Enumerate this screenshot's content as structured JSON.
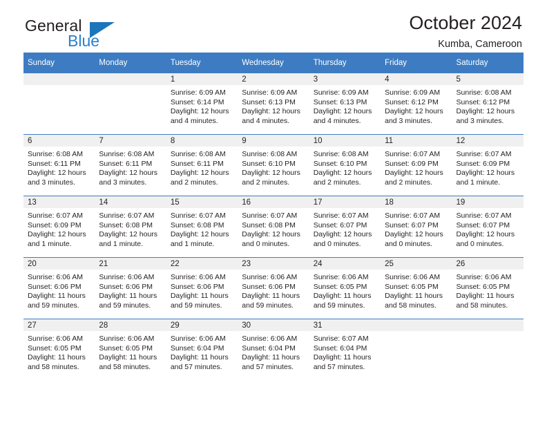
{
  "brand": {
    "name_top": "General",
    "name_bottom": "Blue",
    "accent_color": "#1b75bb",
    "logo_icon": "triangle-icon"
  },
  "header": {
    "title": "October 2024",
    "subtitle": "Kumba, Cameroon"
  },
  "calendar": {
    "header_bg": "#3d7cc2",
    "daynum_bg": "#f0f0f0",
    "weekdays": [
      "Sunday",
      "Monday",
      "Tuesday",
      "Wednesday",
      "Thursday",
      "Friday",
      "Saturday"
    ],
    "weeks": [
      [
        {
          "day": "",
          "empty": true
        },
        {
          "day": "",
          "empty": true
        },
        {
          "day": "1",
          "sunrise": "Sunrise: 6:09 AM",
          "sunset": "Sunset: 6:14 PM",
          "daylight1": "Daylight: 12 hours",
          "daylight2": "and 4 minutes."
        },
        {
          "day": "2",
          "sunrise": "Sunrise: 6:09 AM",
          "sunset": "Sunset: 6:13 PM",
          "daylight1": "Daylight: 12 hours",
          "daylight2": "and 4 minutes."
        },
        {
          "day": "3",
          "sunrise": "Sunrise: 6:09 AM",
          "sunset": "Sunset: 6:13 PM",
          "daylight1": "Daylight: 12 hours",
          "daylight2": "and 4 minutes."
        },
        {
          "day": "4",
          "sunrise": "Sunrise: 6:09 AM",
          "sunset": "Sunset: 6:12 PM",
          "daylight1": "Daylight: 12 hours",
          "daylight2": "and 3 minutes."
        },
        {
          "day": "5",
          "sunrise": "Sunrise: 6:08 AM",
          "sunset": "Sunset: 6:12 PM",
          "daylight1": "Daylight: 12 hours",
          "daylight2": "and 3 minutes."
        }
      ],
      [
        {
          "day": "6",
          "sunrise": "Sunrise: 6:08 AM",
          "sunset": "Sunset: 6:11 PM",
          "daylight1": "Daylight: 12 hours",
          "daylight2": "and 3 minutes."
        },
        {
          "day": "7",
          "sunrise": "Sunrise: 6:08 AM",
          "sunset": "Sunset: 6:11 PM",
          "daylight1": "Daylight: 12 hours",
          "daylight2": "and 3 minutes."
        },
        {
          "day": "8",
          "sunrise": "Sunrise: 6:08 AM",
          "sunset": "Sunset: 6:11 PM",
          "daylight1": "Daylight: 12 hours",
          "daylight2": "and 2 minutes."
        },
        {
          "day": "9",
          "sunrise": "Sunrise: 6:08 AM",
          "sunset": "Sunset: 6:10 PM",
          "daylight1": "Daylight: 12 hours",
          "daylight2": "and 2 minutes."
        },
        {
          "day": "10",
          "sunrise": "Sunrise: 6:08 AM",
          "sunset": "Sunset: 6:10 PM",
          "daylight1": "Daylight: 12 hours",
          "daylight2": "and 2 minutes."
        },
        {
          "day": "11",
          "sunrise": "Sunrise: 6:07 AM",
          "sunset": "Sunset: 6:09 PM",
          "daylight1": "Daylight: 12 hours",
          "daylight2": "and 2 minutes."
        },
        {
          "day": "12",
          "sunrise": "Sunrise: 6:07 AM",
          "sunset": "Sunset: 6:09 PM",
          "daylight1": "Daylight: 12 hours",
          "daylight2": "and 1 minute."
        }
      ],
      [
        {
          "day": "13",
          "sunrise": "Sunrise: 6:07 AM",
          "sunset": "Sunset: 6:09 PM",
          "daylight1": "Daylight: 12 hours",
          "daylight2": "and 1 minute."
        },
        {
          "day": "14",
          "sunrise": "Sunrise: 6:07 AM",
          "sunset": "Sunset: 6:08 PM",
          "daylight1": "Daylight: 12 hours",
          "daylight2": "and 1 minute."
        },
        {
          "day": "15",
          "sunrise": "Sunrise: 6:07 AM",
          "sunset": "Sunset: 6:08 PM",
          "daylight1": "Daylight: 12 hours",
          "daylight2": "and 1 minute."
        },
        {
          "day": "16",
          "sunrise": "Sunrise: 6:07 AM",
          "sunset": "Sunset: 6:08 PM",
          "daylight1": "Daylight: 12 hours",
          "daylight2": "and 0 minutes."
        },
        {
          "day": "17",
          "sunrise": "Sunrise: 6:07 AM",
          "sunset": "Sunset: 6:07 PM",
          "daylight1": "Daylight: 12 hours",
          "daylight2": "and 0 minutes."
        },
        {
          "day": "18",
          "sunrise": "Sunrise: 6:07 AM",
          "sunset": "Sunset: 6:07 PM",
          "daylight1": "Daylight: 12 hours",
          "daylight2": "and 0 minutes."
        },
        {
          "day": "19",
          "sunrise": "Sunrise: 6:07 AM",
          "sunset": "Sunset: 6:07 PM",
          "daylight1": "Daylight: 12 hours",
          "daylight2": "and 0 minutes."
        }
      ],
      [
        {
          "day": "20",
          "sunrise": "Sunrise: 6:06 AM",
          "sunset": "Sunset: 6:06 PM",
          "daylight1": "Daylight: 11 hours",
          "daylight2": "and 59 minutes."
        },
        {
          "day": "21",
          "sunrise": "Sunrise: 6:06 AM",
          "sunset": "Sunset: 6:06 PM",
          "daylight1": "Daylight: 11 hours",
          "daylight2": "and 59 minutes."
        },
        {
          "day": "22",
          "sunrise": "Sunrise: 6:06 AM",
          "sunset": "Sunset: 6:06 PM",
          "daylight1": "Daylight: 11 hours",
          "daylight2": "and 59 minutes."
        },
        {
          "day": "23",
          "sunrise": "Sunrise: 6:06 AM",
          "sunset": "Sunset: 6:06 PM",
          "daylight1": "Daylight: 11 hours",
          "daylight2": "and 59 minutes."
        },
        {
          "day": "24",
          "sunrise": "Sunrise: 6:06 AM",
          "sunset": "Sunset: 6:05 PM",
          "daylight1": "Daylight: 11 hours",
          "daylight2": "and 59 minutes."
        },
        {
          "day": "25",
          "sunrise": "Sunrise: 6:06 AM",
          "sunset": "Sunset: 6:05 PM",
          "daylight1": "Daylight: 11 hours",
          "daylight2": "and 58 minutes."
        },
        {
          "day": "26",
          "sunrise": "Sunrise: 6:06 AM",
          "sunset": "Sunset: 6:05 PM",
          "daylight1": "Daylight: 11 hours",
          "daylight2": "and 58 minutes."
        }
      ],
      [
        {
          "day": "27",
          "sunrise": "Sunrise: 6:06 AM",
          "sunset": "Sunset: 6:05 PM",
          "daylight1": "Daylight: 11 hours",
          "daylight2": "and 58 minutes."
        },
        {
          "day": "28",
          "sunrise": "Sunrise: 6:06 AM",
          "sunset": "Sunset: 6:05 PM",
          "daylight1": "Daylight: 11 hours",
          "daylight2": "and 58 minutes."
        },
        {
          "day": "29",
          "sunrise": "Sunrise: 6:06 AM",
          "sunset": "Sunset: 6:04 PM",
          "daylight1": "Daylight: 11 hours",
          "daylight2": "and 57 minutes."
        },
        {
          "day": "30",
          "sunrise": "Sunrise: 6:06 AM",
          "sunset": "Sunset: 6:04 PM",
          "daylight1": "Daylight: 11 hours",
          "daylight2": "and 57 minutes."
        },
        {
          "day": "31",
          "sunrise": "Sunrise: 6:07 AM",
          "sunset": "Sunset: 6:04 PM",
          "daylight1": "Daylight: 11 hours",
          "daylight2": "and 57 minutes."
        },
        {
          "day": "",
          "empty": true
        },
        {
          "day": "",
          "empty": true
        }
      ]
    ]
  }
}
